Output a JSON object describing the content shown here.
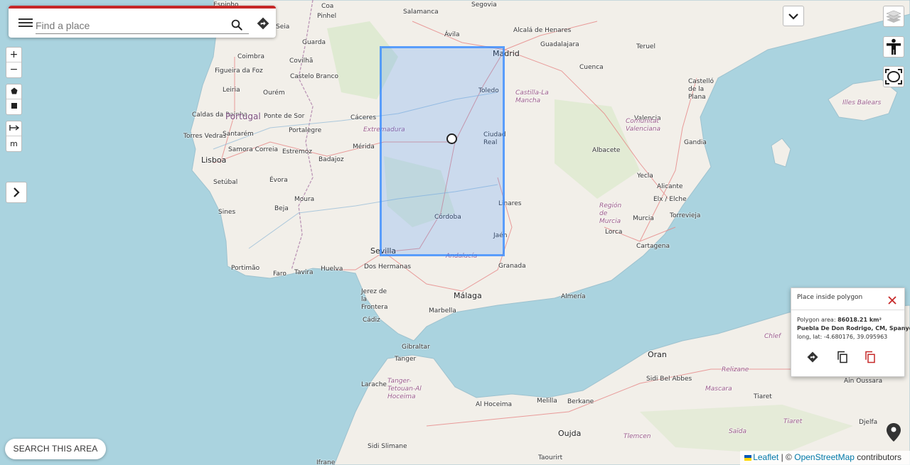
{
  "search": {
    "placeholder": "Find a place"
  },
  "zoom": {
    "in_label": "+",
    "out_label": "−"
  },
  "measure": {
    "unit_label": "m"
  },
  "popup": {
    "title": "Place inside polygon",
    "area_label": "Polygon area:",
    "area_value": "86018.21 km²",
    "place_name": "Puebla De Don Rodrigo, CM, Spanyol",
    "coords_label": "long, lat:",
    "coords_value": "-4.680176, 39.095963"
  },
  "search_area_button": "SEARCH THIS AREA",
  "attribution": {
    "leaflet": "Leaflet",
    "separator": "|",
    "copyright": "©",
    "osm": "OpenStreetMap",
    "contributors": "contributors"
  },
  "map_labels": {
    "countries": [
      "Portugal"
    ],
    "regions": [
      "Extremadura",
      "Castilla-La Mancha",
      "Comunitat Valenciana",
      "Región de Murcia",
      "Andalucía",
      "Illes Balears",
      "Tanger-Tetouan-Al Hoceima",
      "Chlef",
      "Relizane",
      "Mascara",
      "Tiaret",
      "Saïda",
      "Tlemcen"
    ],
    "cities": [
      "Salamanca",
      "Segovia",
      "Ávila",
      "Alcalá de Henares",
      "Madrid",
      "Guadalajara",
      "Teruel",
      "Cuenca",
      "Toledo",
      "Guarda",
      "Covilhã",
      "Castelo Branco",
      "Coimbra",
      "Figueira da Foz",
      "Leiria",
      "Caldas da Rainha",
      "Torres Vedras",
      "Lisboa",
      "Setúbal",
      "Santarém",
      "Samora Correia",
      "Ponte de Sor",
      "Portalegre",
      "Estremoz",
      "Évora",
      "Badajoz",
      "Mérida",
      "Cáceres",
      "Ciudad Real",
      "Albacete",
      "Castelló de la Plana",
      "Valencia",
      "Gandia",
      "Yecla",
      "Alicante",
      "Elx / Elche",
      "Torrevieja",
      "Murcia",
      "Lorca",
      "Cartagena",
      "Linares",
      "Jaén",
      "Córdoba",
      "Sevilla",
      "Dos Hermanas",
      "Huelva",
      "Granada",
      "Málaga",
      "Almería",
      "Jerez de la Frontera",
      "Cádiz",
      "Marbella",
      "Gibraltar",
      "Tanger",
      "Larache",
      "Sines",
      "Beja",
      "Moura",
      "Portimão",
      "Faro",
      "Tavira",
      "Ourém",
      "Pinhel",
      "Coa",
      "Espinho",
      "Seia",
      "Ifrane",
      "Sidi Slimane",
      "Al Hoceima",
      "Melilla",
      "Berkane",
      "Oujda",
      "Oran",
      "Sidi Bel Abbes",
      "Tiaret",
      "Ain Oussara",
      "Djelfa",
      "Taourirt"
    ]
  }
}
